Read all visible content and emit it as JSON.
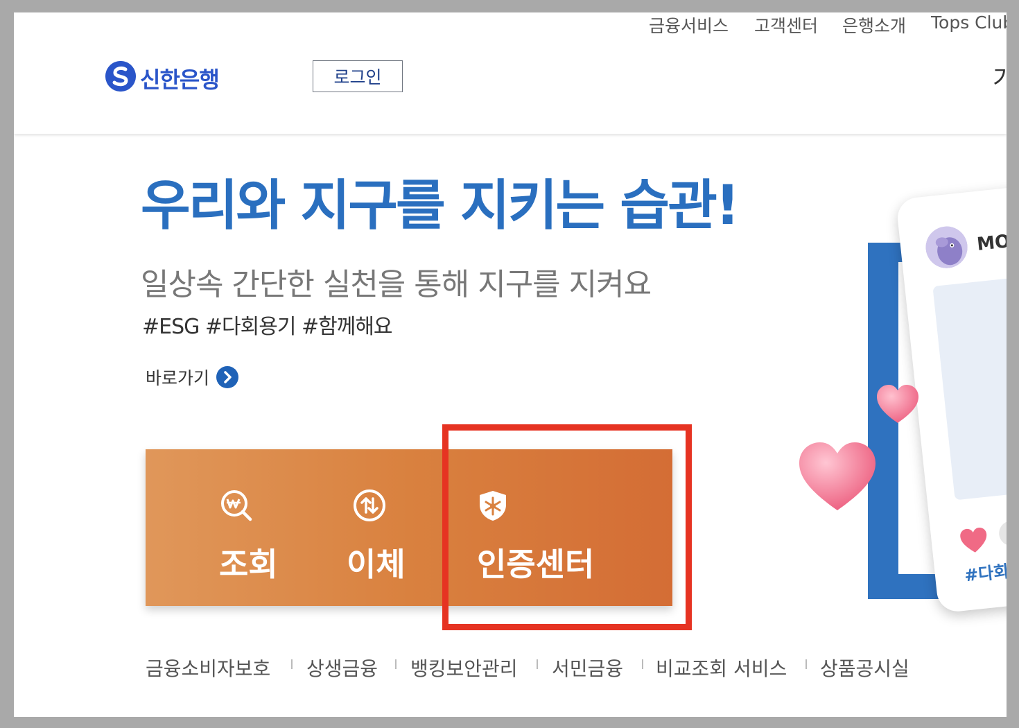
{
  "header": {
    "utility_nav": [
      {
        "label": "금융서비스"
      },
      {
        "label": "고객센터"
      },
      {
        "label": "은행소개"
      },
      {
        "label": "Tops Club"
      }
    ],
    "logo_text": "신한은행",
    "login_label": "로그인",
    "edge_text": "기"
  },
  "hero": {
    "title": "우리와 지구를 지키는 습관!",
    "subtitle": "일상속 간단한 실천을 통해 지구를 지켜요",
    "tags": "#ESG #다회용기 #함께해요",
    "shortcut_label": "바로가기"
  },
  "quick_menu": [
    {
      "label": "조회",
      "icon": "won-search-icon"
    },
    {
      "label": "이체",
      "icon": "transfer-arrows-icon"
    },
    {
      "label": "인증센터",
      "icon": "shield-icon"
    }
  ],
  "footer_links": [
    {
      "label": "금융소비자보호"
    },
    {
      "label": "상생금융"
    },
    {
      "label": "뱅킹보안관리"
    },
    {
      "label": "서민금융"
    },
    {
      "label": "비교조회 서비스"
    },
    {
      "label": "상품공시실"
    }
  ],
  "illustration": {
    "username": "MOLI",
    "tag": "#다회용"
  },
  "colors": {
    "brand_blue": "#2a55c9",
    "hero_title": "#2a6fbf",
    "quick_menu_start": "#e0975a",
    "quick_menu_end": "#d46d35",
    "highlight": "#e63322"
  }
}
